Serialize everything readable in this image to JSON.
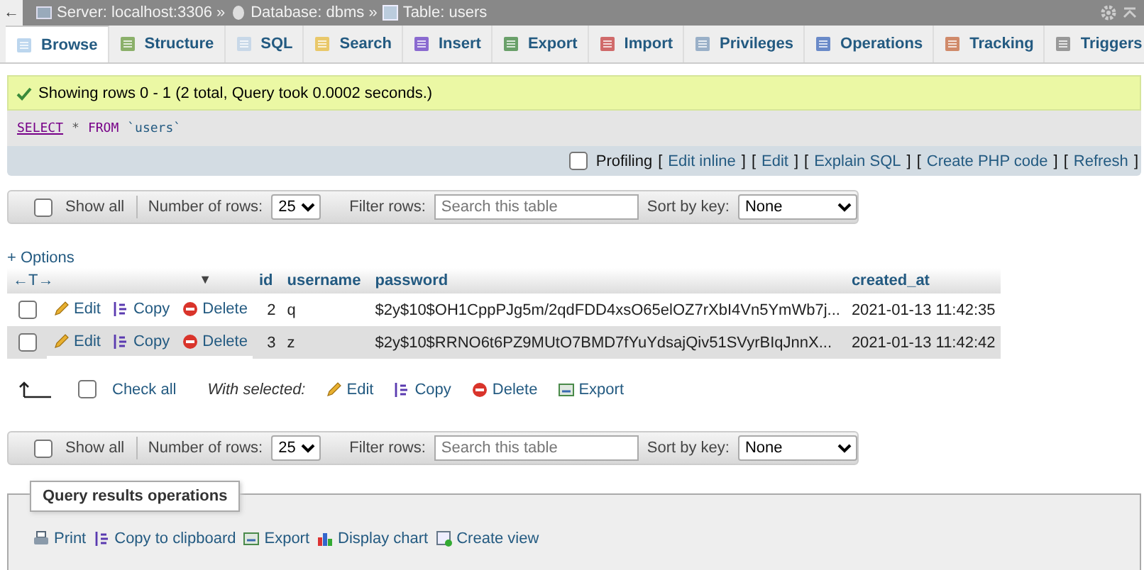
{
  "breadcrumb": [
    {
      "label": "Server: localhost:3306",
      "sep": "»"
    },
    {
      "label": "Database: dbms",
      "sep": "»"
    },
    {
      "label": "Table: users"
    }
  ],
  "back": "←",
  "tabs": [
    {
      "label": "Browse",
      "selected": true
    },
    {
      "label": "Structure",
      "selected": false
    },
    {
      "label": "SQL",
      "selected": false
    },
    {
      "label": "Search",
      "selected": false
    },
    {
      "label": "Insert",
      "selected": false
    },
    {
      "label": "Export",
      "selected": false
    },
    {
      "label": "Import",
      "selected": false
    },
    {
      "label": "Privileges",
      "selected": false
    },
    {
      "label": "Operations",
      "selected": false
    },
    {
      "label": "Tracking",
      "selected": false
    },
    {
      "label": "Triggers",
      "selected": false
    }
  ],
  "message": "Showing rows 0 - 1 (2 total, Query took 0.0002 seconds.)",
  "query": {
    "keyword": "SELECT",
    "star": "*",
    "from": "FROM",
    "table": "`users`"
  },
  "profiling": {
    "label": "Profiling",
    "checked": false,
    "links": [
      {
        "open": "[",
        "label": "Edit inline",
        "close": "]"
      },
      {
        "open": "[",
        "label": "Edit",
        "close": "]"
      },
      {
        "open": "[",
        "label": "Explain SQL",
        "close": "]"
      },
      {
        "open": "[",
        "label": "Create PHP code",
        "close": "]"
      },
      {
        "open": "[",
        "label": "Refresh",
        "close": "]"
      }
    ]
  },
  "navigators": [
    {
      "show_all": "Show all",
      "show_all_checked": false,
      "rows_label": "Number of rows:",
      "rows_value": "25",
      "filter_label": "Filter rows:",
      "filter_placeholder": "Search this table",
      "sort_label": "Sort by key:",
      "sort_value": "None"
    },
    {
      "show_all": "Show all",
      "show_all_checked": false,
      "rows_label": "Number of rows:",
      "rows_value": "25",
      "filter_label": "Filter rows:",
      "filter_placeholder": "Search this table",
      "sort_label": "Sort by key:",
      "sort_value": "None"
    }
  ],
  "options": "+ Options",
  "table": {
    "arrows": "←T→",
    "sort_caret": "▼",
    "columns": [
      "id",
      "username",
      "password",
      "created_at"
    ],
    "rows": [
      {
        "checked": false,
        "edit": "Edit",
        "copy": "Copy",
        "delete": "Delete",
        "cells": [
          "2",
          "q",
          "$2y$10$OH1CppPJg5m/2qdFDD4xsO65elOZ7rXbI4Vn5YmWb7j...",
          "2021-01-13 11:42:35"
        ]
      },
      {
        "checked": false,
        "edit": "Edit",
        "copy": "Copy",
        "delete": "Delete",
        "cells": [
          "3",
          "z",
          "$2y$10$RRNO6t6PZ9MUtO7BMD7fYuYdsajQiv51SVyrBIqJnnX...",
          "2021-01-13 11:42:42"
        ]
      }
    ]
  },
  "bulk": {
    "check_all": "Check all",
    "checked": false,
    "with_selected": "With selected:",
    "actions": [
      "Edit",
      "Copy",
      "Delete",
      "Export"
    ]
  },
  "operations": {
    "legend": "Query results operations",
    "links": [
      "Print",
      "Copy to clipboard",
      "Export",
      "Display chart",
      "Create view"
    ]
  }
}
